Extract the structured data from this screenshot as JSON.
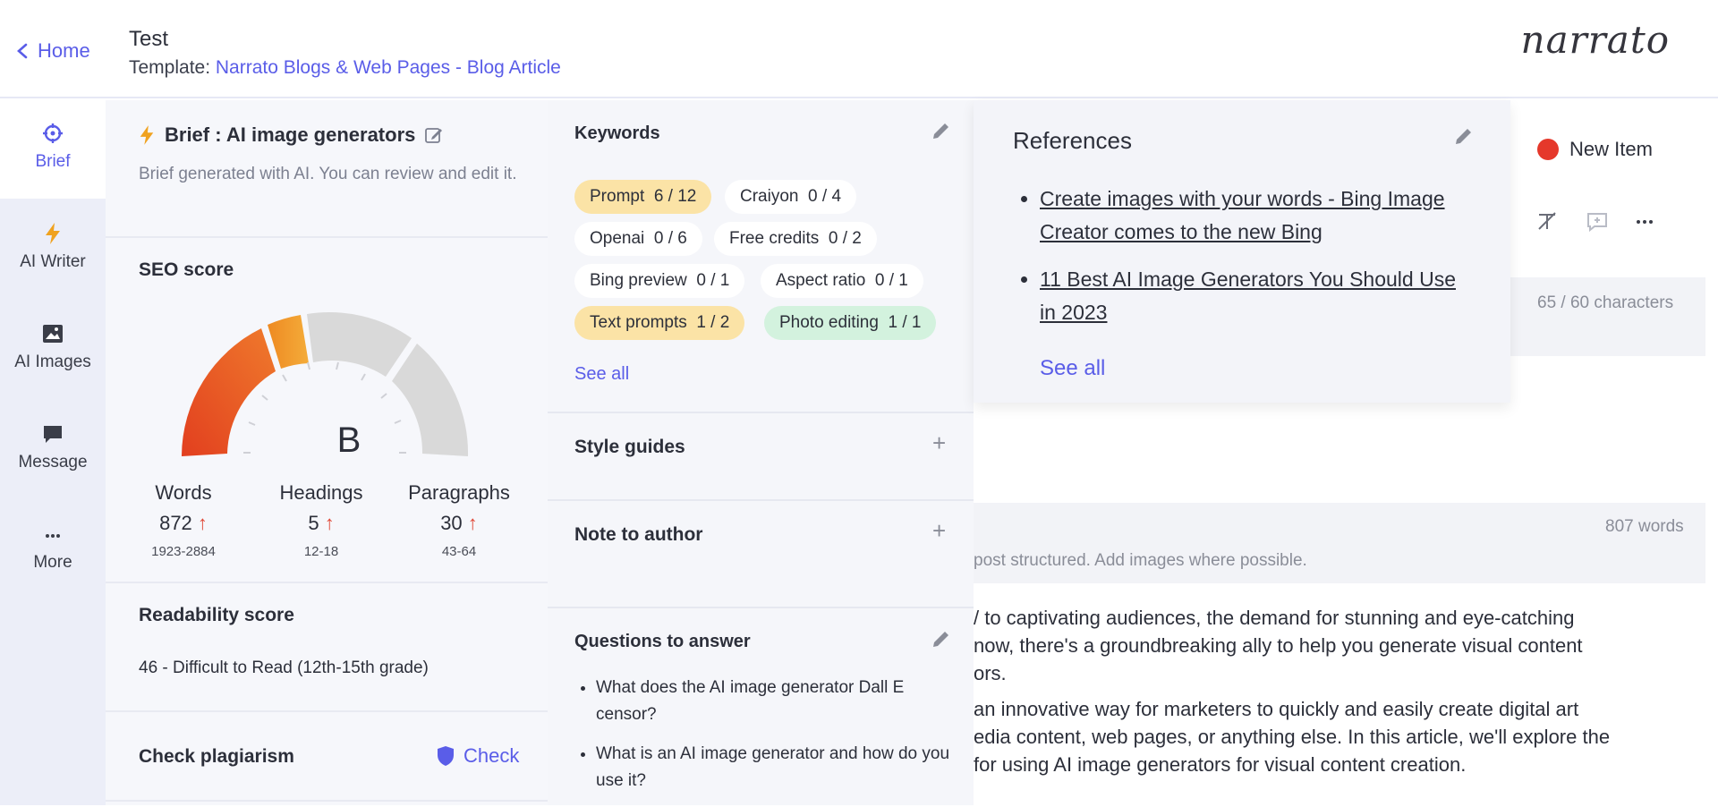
{
  "header": {
    "home_label": "Home",
    "doc_title": "Test",
    "template_prefix": "Template: ",
    "template_name": "Narrato Blogs & Web Pages - Blog Article",
    "logo_text": "narrato"
  },
  "rail": {
    "items": [
      {
        "label": "Brief",
        "icon": "crosshair-icon"
      },
      {
        "label": "AI Writer",
        "icon": "lightning-icon"
      },
      {
        "label": "AI Images",
        "icon": "image-icon"
      },
      {
        "label": "Message",
        "icon": "chat-icon"
      },
      {
        "label": "More",
        "icon": "more-dots-icon"
      }
    ]
  },
  "brief": {
    "title": "Brief : AI image generators",
    "subtitle": "Brief generated with AI. You can review and edit it.",
    "seo_title": "SEO score",
    "seo_grade": "B",
    "stats": [
      {
        "label": "Words",
        "value": "872",
        "range": "1923-2884"
      },
      {
        "label": "Headings",
        "value": "5",
        "range": "12-18"
      },
      {
        "label": "Paragraphs",
        "value": "30",
        "range": "43-64"
      }
    ],
    "readability_title": "Readability score",
    "readability_value": "46 - Difficult to Read (12th-15th grade)",
    "plagiarism_title": "Check plagiarism",
    "plagiarism_action": "Check"
  },
  "mid": {
    "keywords_title": "Keywords",
    "keywords": [
      {
        "name": "Prompt",
        "count": "6 / 12",
        "status": "warn"
      },
      {
        "name": "Craiyon",
        "count": "0 / 4",
        "status": "none"
      },
      {
        "name": "Openai",
        "count": "0 / 6",
        "status": "none"
      },
      {
        "name": "Free credits",
        "count": "0 / 2",
        "status": "none"
      },
      {
        "name": "Bing preview",
        "count": "0 / 1",
        "status": "none"
      },
      {
        "name": "Aspect ratio",
        "count": "0 / 1",
        "status": "none"
      },
      {
        "name": "Text prompts",
        "count": "1 / 2",
        "status": "warn"
      },
      {
        "name": "Photo editing",
        "count": "1 / 1",
        "status": "done"
      }
    ],
    "see_all": "See all",
    "style_guides": "Style guides",
    "note_to_author": "Note to author",
    "questions_title": "Questions to answer",
    "questions": [
      "What does the AI image generator Dall E censor?",
      "What is an AI image generator and how do you use it?"
    ]
  },
  "references": {
    "title": "References",
    "items": [
      "Create images with your words - Bing Image Creator comes to the new Bing",
      "11 Best AI Image Generators You Should Use in 2023"
    ],
    "see_all": "See all"
  },
  "editor": {
    "new_item": "New Item",
    "char_count": "65 / 60 characters",
    "word_count": "807 words",
    "hint": "post structured. Add images where possible.",
    "para1": [
      "/ to captivating audiences, the demand for stunning and eye-catching",
      "now, there's a groundbreaking ally to help you generate visual content",
      "ors."
    ],
    "para2": [
      "an innovative way for marketers to quickly and easily create digital art",
      "edia content, web pages, or anything else. In this article, we'll explore the",
      "for using AI image generators for visual content creation."
    ]
  },
  "colors": {
    "accent": "#5a5de8",
    "warn": "#fbe3a6",
    "done": "#d3f2de",
    "danger": "#e04938"
  }
}
